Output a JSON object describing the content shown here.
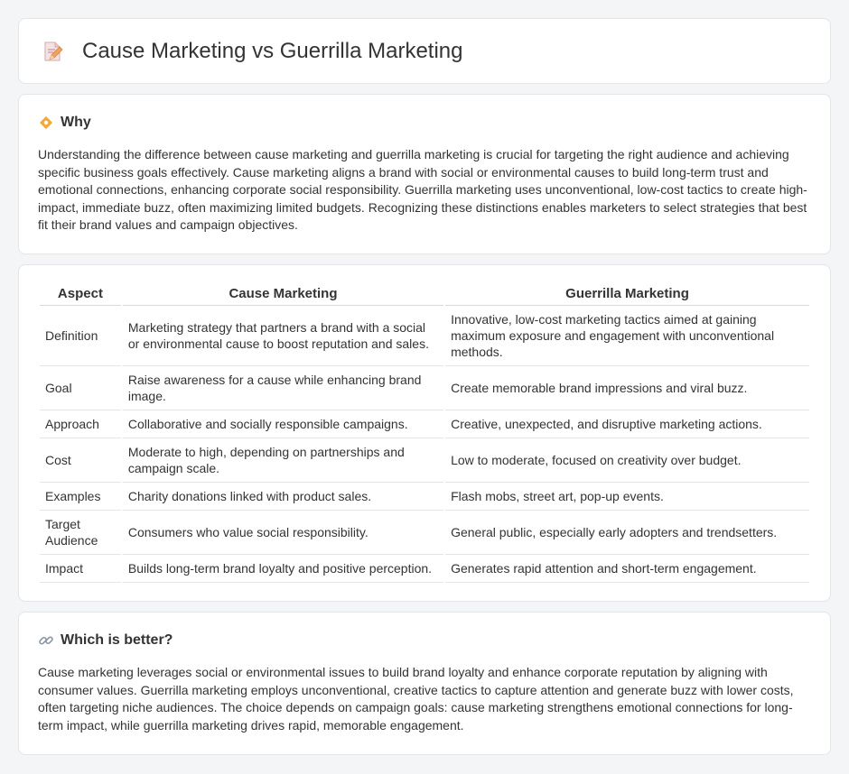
{
  "header": {
    "title": "Cause Marketing vs Guerrilla Marketing",
    "icon": "document-pencil-icon"
  },
  "why": {
    "title": "Why",
    "icon": "diamond-icon",
    "text": "Understanding the difference between cause marketing and guerrilla marketing is crucial for targeting the right audience and achieving specific business goals effectively. Cause marketing aligns a brand with social or environmental causes to build long-term trust and emotional connections, enhancing corporate social responsibility. Guerrilla marketing uses unconventional, low-cost tactics to create high-impact, immediate buzz, often maximizing limited budgets. Recognizing these distinctions enables marketers to select strategies that best fit their brand values and campaign objectives."
  },
  "table": {
    "headers": [
      "Aspect",
      "Cause Marketing",
      "Guerrilla Marketing"
    ],
    "rows": [
      [
        "Definition",
        "Marketing strategy that partners a brand with a social or environmental cause to boost reputation and sales.",
        "Innovative, low-cost marketing tactics aimed at gaining maximum exposure and engagement with unconventional methods."
      ],
      [
        "Goal",
        "Raise awareness for a cause while enhancing brand image.",
        "Create memorable brand impressions and viral buzz."
      ],
      [
        "Approach",
        "Collaborative and socially responsible campaigns.",
        "Creative, unexpected, and disruptive marketing actions."
      ],
      [
        "Cost",
        "Moderate to high, depending on partnerships and campaign scale.",
        "Low to moderate, focused on creativity over budget."
      ],
      [
        "Examples",
        "Charity donations linked with product sales.",
        "Flash mobs, street art, pop-up events."
      ],
      [
        "Target Audience",
        "Consumers who value social responsibility.",
        "General public, especially early adopters and trendsetters."
      ],
      [
        "Impact",
        "Builds long-term brand loyalty and positive perception.",
        "Generates rapid attention and short-term engagement."
      ]
    ]
  },
  "better": {
    "title": "Which is better?",
    "icon": "link-icon",
    "text": "Cause marketing leverages social or environmental issues to build brand loyalty and enhance corporate reputation by aligning with consumer values. Guerrilla marketing employs unconventional, creative tactics to capture attention and generate buzz with lower costs, often targeting niche audiences. The choice depends on campaign goals: cause marketing strengthens emotional connections for long-term impact, while guerrilla marketing drives rapid, memorable engagement."
  }
}
